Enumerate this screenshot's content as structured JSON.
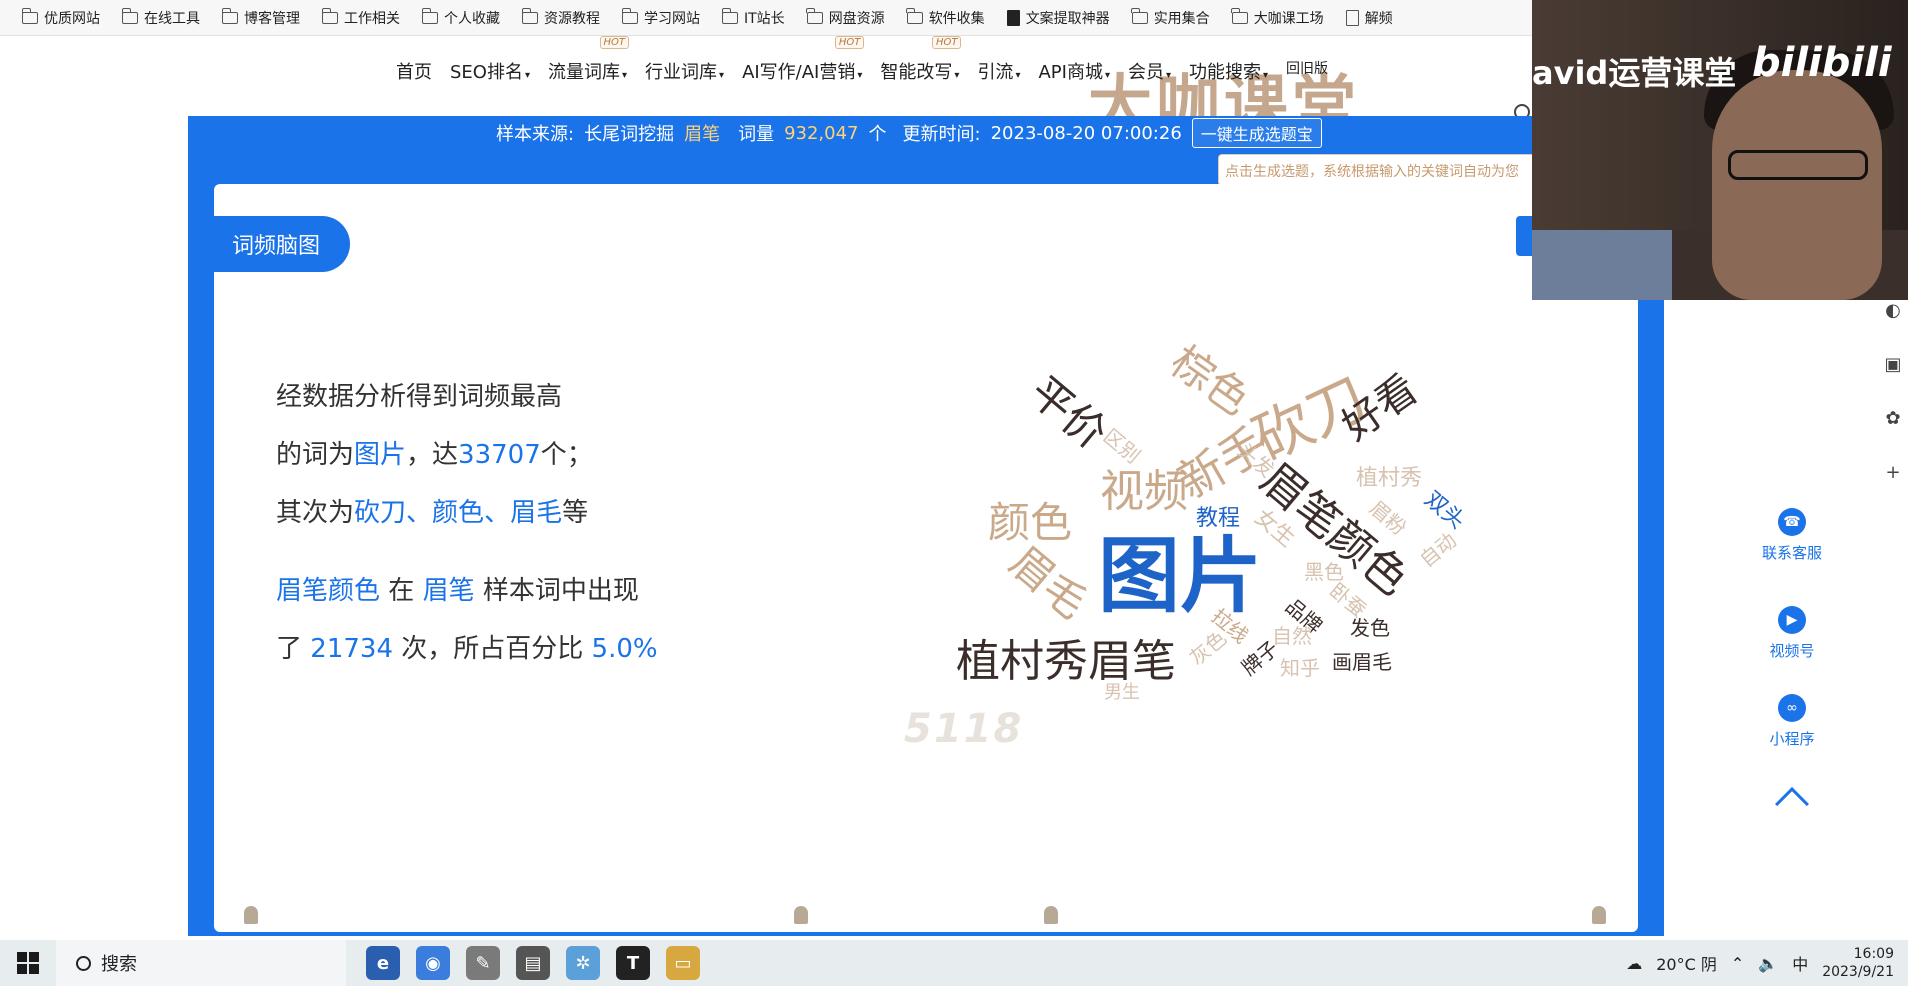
{
  "bookmarks": [
    {
      "label": "优质网站",
      "icon": "folder-icon"
    },
    {
      "label": "在线工具",
      "icon": "folder-icon"
    },
    {
      "label": "博客管理",
      "icon": "folder-icon"
    },
    {
      "label": "工作相关",
      "icon": "folder-icon"
    },
    {
      "label": "个人收藏",
      "icon": "folder-icon"
    },
    {
      "label": "资源教程",
      "icon": "folder-icon"
    },
    {
      "label": "学习网站",
      "icon": "folder-icon"
    },
    {
      "label": "IT站长",
      "icon": "folder-icon"
    },
    {
      "label": "网盘资源",
      "icon": "folder-icon"
    },
    {
      "label": "软件收集",
      "icon": "folder-icon"
    },
    {
      "label": "文案提取神器",
      "icon": "app-icon"
    },
    {
      "label": "实用集合",
      "icon": "folder-icon"
    },
    {
      "label": "大咖课工场",
      "icon": "folder-icon"
    },
    {
      "label": "解频",
      "icon": "document-icon"
    }
  ],
  "nav": {
    "items": [
      {
        "label": "首页",
        "caret": "",
        "hot": ""
      },
      {
        "label": "SEO排名",
        "caret": "▾",
        "hot": ""
      },
      {
        "label": "流量词库",
        "caret": "▾",
        "hot": "HOT"
      },
      {
        "label": "行业词库",
        "caret": "▾",
        "hot": ""
      },
      {
        "label": "AI写作/AI营销",
        "caret": "▾",
        "hot": "HOT"
      },
      {
        "label": "智能改写",
        "caret": "▾",
        "hot": "HOT"
      },
      {
        "label": "引流",
        "caret": "▾",
        "hot": ""
      },
      {
        "label": "API商城",
        "caret": "▾",
        "hot": ""
      },
      {
        "label": "会员",
        "caret": "▾",
        "hot": ""
      },
      {
        "label": "功能搜索",
        "caret": "▾",
        "hot": ""
      },
      {
        "label": "回旧版",
        "caret": "",
        "hot": ""
      }
    ],
    "watermark": "大咖课堂"
  },
  "sample": {
    "source_label": "样本来源:",
    "source_value": "长尾词挖掘",
    "keyword": "眉笔",
    "count_label": "词量",
    "count_value": "932,047",
    "count_unit": "个",
    "updated_label": "更新时间:",
    "updated_value": "2023-08-20 07:00:26",
    "generate_button": "一键生成选题宝",
    "tooltip": "点击生成选题，系统根据输入的关键词自动为您"
  },
  "card": {
    "tag": "词频脑图",
    "analysis": {
      "line1": "经数据分析得到词频最高",
      "line2_a": "的词为",
      "line2_top": "图片",
      "line2_b": "，达",
      "line2_count": "33707",
      "line2_c": "个；",
      "line3_a": "其次为",
      "line3_w1": "砍刀",
      "line3_sep1": "、",
      "line3_w2": "颜色",
      "line3_sep2": "、",
      "line3_w3": "眉毛",
      "line3_b": "等",
      "line4_kw": "眉笔颜色",
      "line4_a": "在",
      "line4_sample": "眉笔",
      "line4_b": "样本词中出现",
      "line5_a": "了",
      "line5_count": "21734",
      "line5_b": "次，所占百分比",
      "line5_pct": "5.0%"
    },
    "cloud_words": [
      "图片",
      "植村秀眉笔",
      "砍刀",
      "眉笔颜色",
      "颜色",
      "眉毛",
      "视频",
      "新手",
      "棕色",
      "平价",
      "好看",
      "区别",
      "头发",
      "植村秀",
      "双头",
      "教程",
      "女生",
      "眉粉",
      "自动",
      "黑色",
      "卧蚕",
      "品牌",
      "发色",
      "自然",
      "拉线",
      "灰色",
      "牌子",
      "知乎",
      "画眉毛",
      "男生"
    ],
    "logo": "5118"
  },
  "webcam": {
    "channel_text": "avid运营课堂",
    "logo": "bilibili"
  },
  "rail": {
    "service": "联系客服",
    "video": "视频号",
    "miniprogram": "小程序"
  },
  "taskbar": {
    "search": "搜索",
    "weather": "20°C 阴",
    "ime": "中",
    "time": "16:09",
    "date": "2023/9/21"
  },
  "colors": {
    "brand_blue": "#1a73e8",
    "tan": "#c9a98a",
    "dark": "#3b2e2a"
  }
}
